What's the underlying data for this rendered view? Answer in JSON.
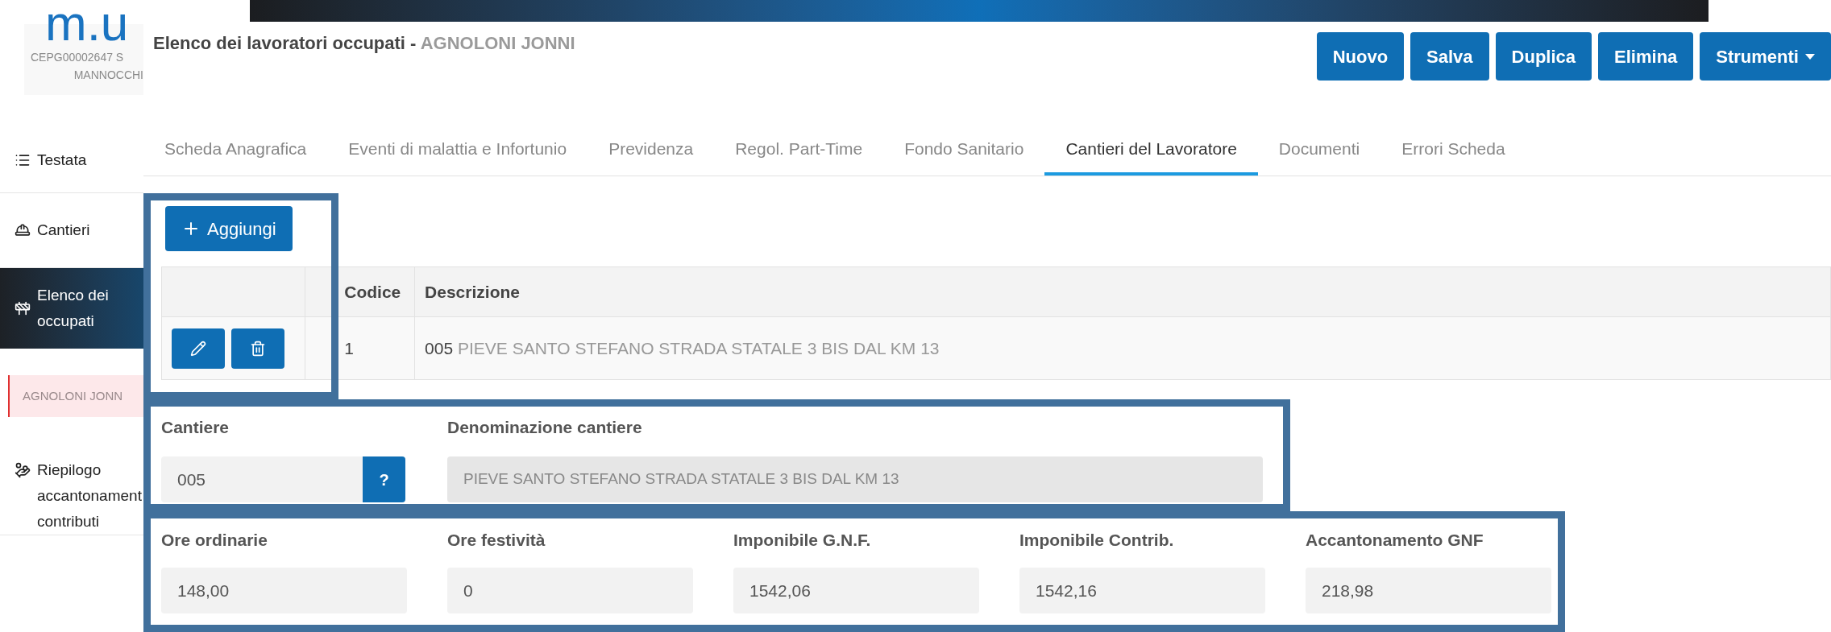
{
  "sidebar": {
    "logo": "m.u",
    "company_code": "CEPG00002647 S",
    "company_name": "MANNOCCHI",
    "items": [
      {
        "label": "Testata",
        "selected": false
      },
      {
        "label": "Cantieri",
        "selected": false
      },
      {
        "label": "Elenco dei occupati",
        "selected": true
      },
      {
        "label": "Riepilogo accantonament contributi",
        "selected": false
      }
    ],
    "current_worker": "AGNOLONI JONN"
  },
  "header": {
    "title": "Elenco dei lavoratori occupati - ",
    "worker_name": "AGNOLONI JONNI",
    "actions": [
      "Nuovo",
      "Salva",
      "Duplica",
      "Elimina",
      "Strumenti"
    ]
  },
  "tabs": [
    {
      "label": "Scheda Anagrafica",
      "selected": false
    },
    {
      "label": "Eventi di malattia e Infortunio",
      "selected": false
    },
    {
      "label": "Previdenza",
      "selected": false
    },
    {
      "label": "Regol. Part-Time",
      "selected": false
    },
    {
      "label": "Fondo Sanitario",
      "selected": false
    },
    {
      "label": "Cantieri del Lavoratore",
      "selected": true
    },
    {
      "label": "Documenti",
      "selected": false
    },
    {
      "label": "Errori Scheda",
      "selected": false
    }
  ],
  "add_button": {
    "label": "Aggiungi"
  },
  "table": {
    "columns": [
      "Codice",
      "Descrizione"
    ],
    "rows": [
      {
        "codice": "1",
        "descrizione_code": "005",
        "descrizione": "PIEVE SANTO STEFANO STRADA STATALE 3 BIS DAL KM 13"
      }
    ]
  },
  "site_form": {
    "cantiere": {
      "label": "Cantiere",
      "value": "005",
      "lookup": "?"
    },
    "denominazione": {
      "label": "Denominazione cantiere",
      "value": "PIEVE SANTO STEFANO STRADA STATALE 3 BIS DAL KM 13"
    }
  },
  "amounts": [
    {
      "label": "Ore ordinarie",
      "value": "148,00"
    },
    {
      "label": "Ore festività",
      "value": "0"
    },
    {
      "label": "Imponibile G.N.F.",
      "value": "1542,06"
    },
    {
      "label": "Imponibile Contrib.",
      "value": "1542,16"
    },
    {
      "label": "Accantonamento GNF",
      "value": "218,98"
    }
  ]
}
